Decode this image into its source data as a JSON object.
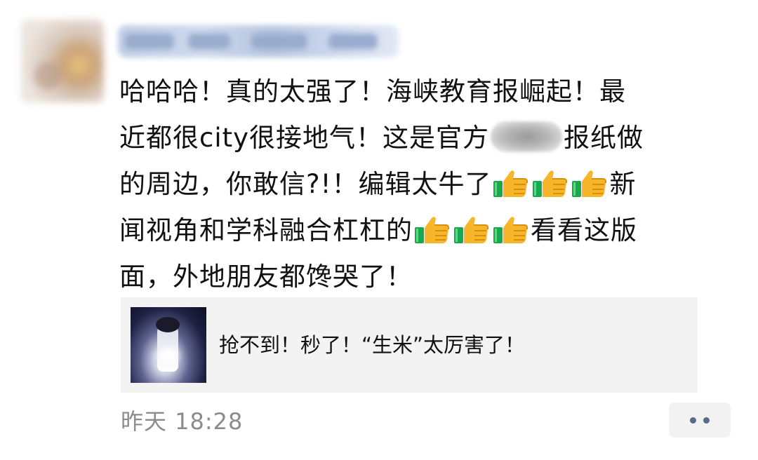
{
  "post": {
    "author_avatar_icon": "avatar-blurred",
    "text": {
      "line1": "哈哈哈！真的太强了！海峡教育报崛起！最",
      "line2_a": "近都很city很接地气！这是官方",
      "line2_b": "报纸做",
      "line3": "的周边，你敢信?!！编辑太牛了",
      "line3_end": "新",
      "line4": "闻视角和学科融合杠杠的",
      "line4_end": "看看这版",
      "line5": "面，外地朋友都馋哭了！"
    },
    "emoji": "thumbs-up-icon",
    "shared_card": {
      "text": "抢不到！秒了！“生米”太厉害了！"
    },
    "timestamp": "昨天 18:28"
  },
  "colors": {
    "text": "#111111",
    "timestamp": "#8c8c8c",
    "card_bg": "#f3f3f3",
    "more_dots": "#5c6b8a"
  }
}
